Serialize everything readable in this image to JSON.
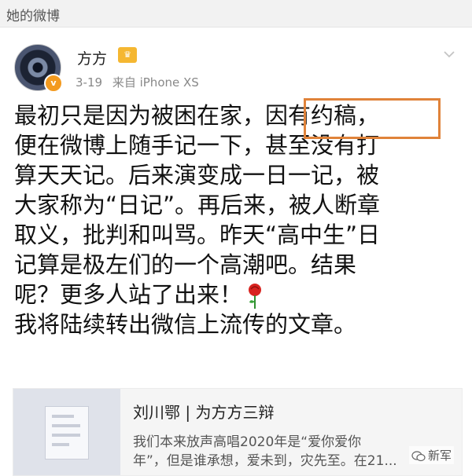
{
  "section": {
    "title": "她的微博"
  },
  "post": {
    "author": "方方",
    "date": "3-19",
    "source": "来自 iPhone XS",
    "lines": [
      "最初只是因为被困在家，因有约稿，",
      "便在微博上随手记一下，甚至没有打",
      "算天天记。后来演变成一日一记，被",
      "大家称为“日记”。再后来，被人断章",
      "取义，批判和叫骂。昨天“高中生”日",
      "记算是极左们的一个高潮吧。结果",
      "呢？更多人站了出来！",
      "我将陆续转出微信上流传的文章。"
    ]
  },
  "card": {
    "title": "刘川鄂 | 为方方三辩",
    "desc_line1": "我们本来放声高唱2020年是“爱你爱你",
    "desc_line2": "年”，但是谁承想，爱未到，灾先至。在21..."
  },
  "corner_logo": {
    "text": "新军"
  },
  "icons": {
    "avatar": "user-avatar",
    "verified": "v-badge-icon",
    "member": "member-crown-icon",
    "menu": "chevron-down-icon",
    "emoji": "rose-icon",
    "thumb": "article-thumbnail-icon",
    "logo": "wechat-icon"
  },
  "colors": {
    "highlight": "#e0833a",
    "verified": "#f39a1f",
    "header_bg": "#f2f2f2"
  }
}
